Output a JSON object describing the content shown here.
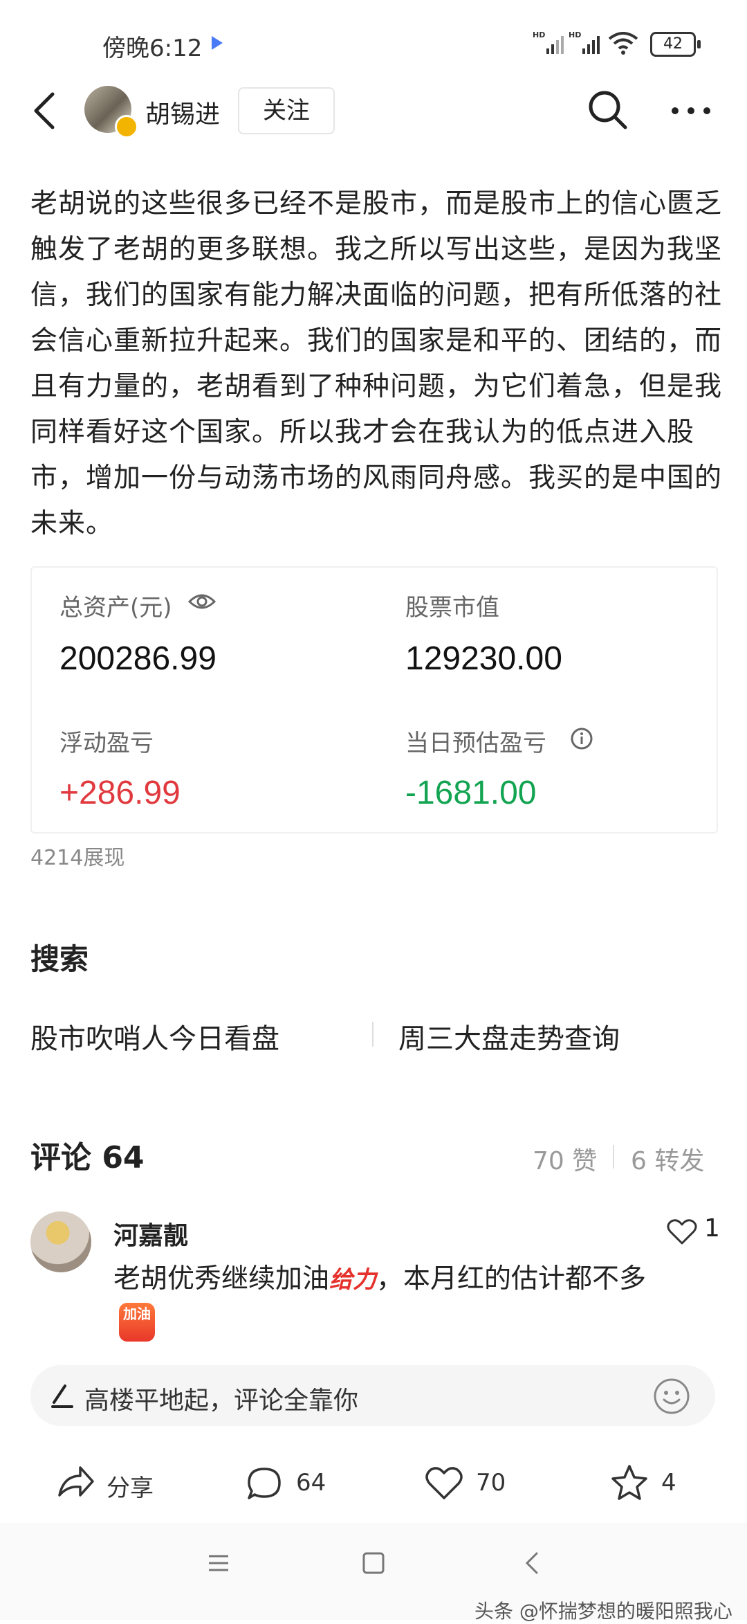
{
  "status_bar": {
    "time": "傍晚6:12",
    "battery": "42"
  },
  "header": {
    "author": "胡锡进",
    "follow_label": "关注"
  },
  "article": {
    "text": "老胡说的这些很多已经不是股市，而是股市上的信心匮乏触发了老胡的更多联想。我之所以写出这些，是因为我坚信，我们的国家有能力解决面临的问题，把有所低落的社会信心重新拉升起来。我们的国家是和平的、团结的，而且有力量的，老胡看到了种种问题，为它们着急，但是我同样看好这个国家。所以我才会在我认为的低点进入股市，增加一份与动荡市场的风雨同舟感。我买的是中国的未来。"
  },
  "assets": {
    "total_label": "总资产(元)",
    "total_value": "200286.99",
    "market_label": "股票市值",
    "market_value": "129230.00",
    "float_label": "浮动盈亏",
    "float_value": "+286.99",
    "daily_label": "当日预估盈亏",
    "daily_value": "-1681.00",
    "colors": {
      "gain": "#e0393e",
      "loss": "#12a451"
    }
  },
  "views": "4214展现",
  "search": {
    "title": "搜索",
    "items": [
      "股市吹哨人今日看盘",
      "周三大盘走势查询"
    ]
  },
  "comments": {
    "title": "评论 64",
    "likes": "70 赞",
    "reposts": "6 转发",
    "list": [
      {
        "name": "河嘉靓",
        "text_before": "老胡优秀继续加油",
        "sticker": "给力",
        "text_after": "，本月红的估计都不多",
        "emoji": "加油",
        "likes": "1"
      }
    ]
  },
  "comment_input": {
    "placeholder": "高楼平地起，评论全靠你"
  },
  "actions": {
    "share": "分享",
    "comment_count": "64",
    "like_count": "70",
    "favorite_count": "4"
  },
  "watermark": "头条 @怀揣梦想的暖阳照我心"
}
